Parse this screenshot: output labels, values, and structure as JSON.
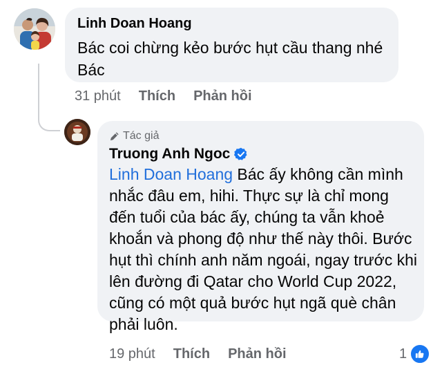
{
  "comment": {
    "author": "Linh Doan Hoang",
    "text": "Bác coi chừng kẻo bước hụt cầu thang nhé Bác",
    "time": "31 phút",
    "like_label": "Thích",
    "reply_label": "Phản hồi",
    "avatar_icon": "family-photo-avatar"
  },
  "reply": {
    "author_badge": "Tác giả",
    "author": "Truong Anh Ngoc",
    "verified_icon": "verified-badge-icon",
    "mention": "Linh Doan Hoang",
    "text": " Bác ấy không cần mình nhắc đâu em, hihi. Thực sự là chỉ mong đến tuổi của bác ấy, chúng ta vẫn khoẻ khoắn và phong độ như thế này thôi. Bước hụt thì chính anh năm ngoái, ngay trước khi lên đường đi Qatar cho World Cup 2022, cũng có một quả bước hụt ngã què chân phải luôn.",
    "time": "19 phút",
    "like_label": "Thích",
    "reply_label": "Phản hồi",
    "reaction_count": "1",
    "reaction_icon": "like-reaction-icon"
  },
  "colors": {
    "bubble": "#f0f2f5",
    "meta": "#65676b",
    "mention": "#216fdb",
    "brand_blue": "#1877f2"
  }
}
